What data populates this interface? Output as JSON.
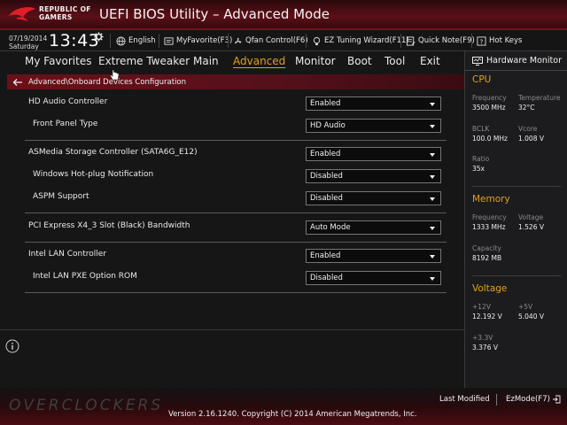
{
  "header": {
    "brand_line1": "REPUBLIC OF",
    "brand_line2": "GAMERS",
    "title": "UEFI BIOS Utility – Advanced Mode",
    "logo_icon": "rog-eye-logo"
  },
  "toolbar": {
    "date": "07/19/2014",
    "day": "Saturday",
    "time": "13:43",
    "items": [
      {
        "label": "English",
        "icon": "globe-icon"
      },
      {
        "label": "MyFavorite(F3)",
        "icon": "favorite-icon"
      },
      {
        "label": "Qfan Control(F6)",
        "icon": "fan-icon"
      },
      {
        "label": "EZ Tuning Wizard(F11)",
        "icon": "bulb-icon"
      },
      {
        "label": "Quick Note(F9)",
        "icon": "note-icon"
      },
      {
        "label": "Hot Keys",
        "icon": "question-icon"
      }
    ]
  },
  "nav": {
    "tabs": [
      "My Favorites",
      "Extreme Tweaker",
      "Main",
      "Advanced",
      "Monitor",
      "Boot",
      "Tool",
      "Exit"
    ],
    "active": "Advanced"
  },
  "breadcrumb": "Advanced\\Onboard Devices Configuration",
  "settings": [
    {
      "label": "HD Audio Controller",
      "value": "Enabled"
    },
    {
      "label": "Front Panel Type",
      "value": "HD Audio"
    },
    {
      "label": "ASMedia Storage Controller (SATA6G_E12)",
      "value": "Enabled"
    },
    {
      "label": "Windows Hot-plug Notification",
      "value": "Disabled"
    },
    {
      "label": "ASPM Support",
      "value": "Disabled"
    },
    {
      "label": "PCI Express X4_3 Slot (Black) Bandwidth",
      "value": "Auto Mode"
    },
    {
      "label": "Intel LAN Controller",
      "value": "Enabled"
    },
    {
      "label": "Intel LAN PXE Option ROM",
      "value": "Disabled"
    }
  ],
  "hardware_monitor": {
    "title": "Hardware Monitor",
    "cpu": {
      "title": "CPU",
      "frequency_label": "Frequency",
      "frequency": "3500 MHz",
      "temperature_label": "Temperature",
      "temperature": "32°C",
      "bclk_label": "BCLK",
      "bclk": "100.0 MHz",
      "vcore_label": "Vcore",
      "vcore": "1.008 V",
      "ratio_label": "Ratio",
      "ratio": "35x"
    },
    "memory": {
      "title": "Memory",
      "frequency_label": "Frequency",
      "frequency": "1333 MHz",
      "voltage_label": "Voltage",
      "voltage": "1.526 V",
      "capacity_label": "Capacity",
      "capacity": "8192 MB"
    },
    "voltage": {
      "title": "Voltage",
      "v12_label": "+12V",
      "v12": "12.192 V",
      "v5_label": "+5V",
      "v5": "5.040 V",
      "v33_label": "+3.3V",
      "v33": "3.376 V"
    }
  },
  "footer": {
    "watermark": "OVERCLOCKERS",
    "last_modified": "Last Modified",
    "ezmode": "EzMode(F7)",
    "version": "Version 2.16.1240. Copyright (C) 2014 American Megatrends, Inc."
  },
  "colors": {
    "accent": "#e0a020",
    "header_red": "#5c0f16",
    "breadcrumb_red": "#6b1018",
    "background": "#161617"
  }
}
